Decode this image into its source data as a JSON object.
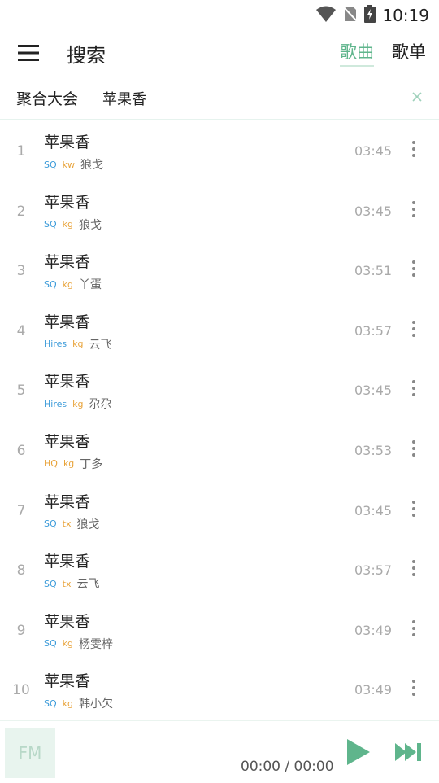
{
  "status": {
    "time": "10:19"
  },
  "header": {
    "title": "搜索",
    "tabs": [
      {
        "label": "歌曲",
        "active": true
      },
      {
        "label": "歌单",
        "active": false
      }
    ]
  },
  "filter": {
    "source": "聚合大会",
    "query": "苹果香"
  },
  "songs": [
    {
      "index": "1",
      "name": "苹果香",
      "quality": "SQ",
      "source": "kw",
      "artist": "狼戈",
      "duration": "03:45"
    },
    {
      "index": "2",
      "name": "苹果香",
      "quality": "SQ",
      "source": "kg",
      "artist": "狼戈",
      "duration": "03:45"
    },
    {
      "index": "3",
      "name": "苹果香",
      "quality": "SQ",
      "source": "kg",
      "artist": "丫蛋",
      "duration": "03:51"
    },
    {
      "index": "4",
      "name": "苹果香",
      "quality": "Hires",
      "source": "kg",
      "artist": "云飞",
      "duration": "03:57"
    },
    {
      "index": "5",
      "name": "苹果香",
      "quality": "Hires",
      "source": "kg",
      "artist": "尕尕",
      "duration": "03:45"
    },
    {
      "index": "6",
      "name": "苹果香",
      "quality": "HQ",
      "source": "kg",
      "artist": "丁多",
      "duration": "03:53"
    },
    {
      "index": "7",
      "name": "苹果香",
      "quality": "SQ",
      "source": "tx",
      "artist": "狼戈",
      "duration": "03:45"
    },
    {
      "index": "8",
      "name": "苹果香",
      "quality": "SQ",
      "source": "tx",
      "artist": "云飞",
      "duration": "03:57"
    },
    {
      "index": "9",
      "name": "苹果香",
      "quality": "SQ",
      "source": "kg",
      "artist": "杨雯梓",
      "duration": "03:49"
    },
    {
      "index": "10",
      "name": "苹果香",
      "quality": "SQ",
      "source": "kg",
      "artist": "韩小欠",
      "duration": "03:49"
    }
  ],
  "player": {
    "fm_label": "FM",
    "time": "00:00 / 00:00"
  },
  "colors": {
    "accent": "#5fb58c",
    "quality_blue": "#3a9ad9",
    "source_orange": "#e8a33a"
  }
}
